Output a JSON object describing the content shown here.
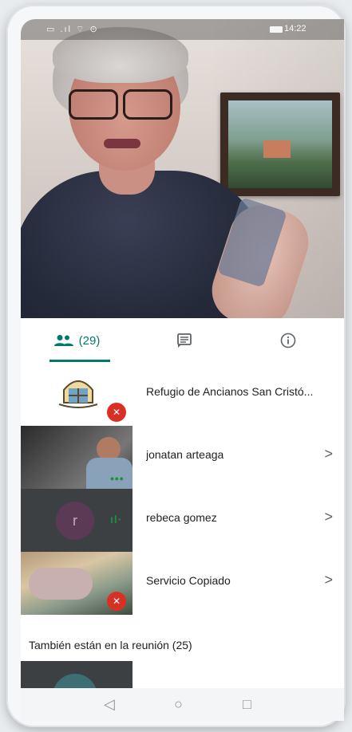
{
  "status_bar": {
    "left_icons": "▭ .ıl ⌔ ⊙",
    "time": "14:22"
  },
  "tabs": [
    {
      "name": "people",
      "icon": "people-icon",
      "label": "(29)"
    },
    {
      "name": "chat",
      "icon": "chat-icon",
      "label": ""
    },
    {
      "name": "info",
      "icon": "info-icon",
      "label": ""
    }
  ],
  "participants": [
    {
      "name": "Refugio de Ancianos San Cristó...",
      "status": "mic-off"
    },
    {
      "name": "jonatan arteaga",
      "status": "more"
    },
    {
      "name": "rebeca gomez",
      "status": "speaking",
      "avatar_letter": "r"
    },
    {
      "name": "Servicio Copiado",
      "status": "mic-off"
    }
  ],
  "also_in_meeting": "También están en la reunión (25)",
  "nav": {
    "back": "◁",
    "home": "○",
    "recents": "□"
  },
  "colors": {
    "accent": "#00796b",
    "mic_off": "#d93025",
    "speaking": "#1e8e3e"
  }
}
